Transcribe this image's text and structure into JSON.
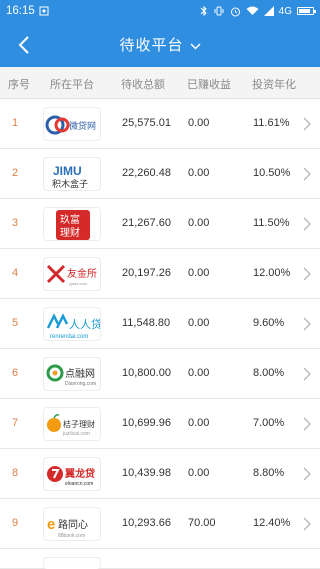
{
  "status_bar": {
    "time": "16:15",
    "network": "4G",
    "battery_level": 0.85,
    "icons": [
      "notification-icon",
      "bluetooth-icon",
      "vibrate-icon",
      "alarm-icon",
      "wifi-icon",
      "signal-icon",
      "battery-icon"
    ]
  },
  "nav": {
    "title": "待收平台",
    "back_icon": "back-arrow-icon",
    "dropdown_icon": "chevron-down-icon"
  },
  "colors": {
    "primary": "#2f8ee0",
    "index_orange": "#d98048",
    "header_text": "#8a8a8a"
  },
  "table": {
    "columns": [
      "序号",
      "所在平台",
      "待收总额",
      "已赚收益",
      "投资年化"
    ],
    "rows": [
      {
        "index": "1",
        "platform": "微贷网",
        "logo_text": "微贷网",
        "amount": "25,575.01",
        "earned": "0.00",
        "rate": "11.61%"
      },
      {
        "index": "2",
        "platform": "积木盒子",
        "logo_text": "JIMU",
        "logo_sub": "积木盒子",
        "amount": "22,260.48",
        "earned": "0.00",
        "rate": "10.50%"
      },
      {
        "index": "3",
        "platform": "玖富理财",
        "logo_text": "玖富",
        "logo_sub": "理财",
        "amount": "21,267.60",
        "earned": "0.00",
        "rate": "11.50%"
      },
      {
        "index": "4",
        "platform": "友金所",
        "logo_text": "友金所",
        "logo_sub": "yyfax.com",
        "amount": "20,197.26",
        "earned": "0.00",
        "rate": "12.00%"
      },
      {
        "index": "5",
        "platform": "人人贷",
        "logo_text": "人人贷",
        "logo_sub": "renrendai.com",
        "amount": "11,548.80",
        "earned": "0.00",
        "rate": "9.60%"
      },
      {
        "index": "6",
        "platform": "点融网",
        "logo_text": "点融网",
        "logo_sub": "Dianrong.com",
        "amount": "10,800.00",
        "earned": "0.00",
        "rate": "8.00%"
      },
      {
        "index": "7",
        "platform": "桔子理财",
        "logo_text": "桔子理财",
        "logo_sub": "juzilicai.com",
        "amount": "10,699.96",
        "earned": "0.00",
        "rate": "7.00%"
      },
      {
        "index": "8",
        "platform": "翼龙贷",
        "logo_text": "翼龙贷",
        "logo_sub": "eloancn.com",
        "amount": "10,439.98",
        "earned": "0.00",
        "rate": "8.80%"
      },
      {
        "index": "9",
        "platform": "e路同心",
        "logo_text": "路同心",
        "logo_prefix": "e",
        "logo_sub": "88bank.com",
        "amount": "10,293.66",
        "earned": "70.00",
        "rate": "12.40%"
      }
    ]
  }
}
